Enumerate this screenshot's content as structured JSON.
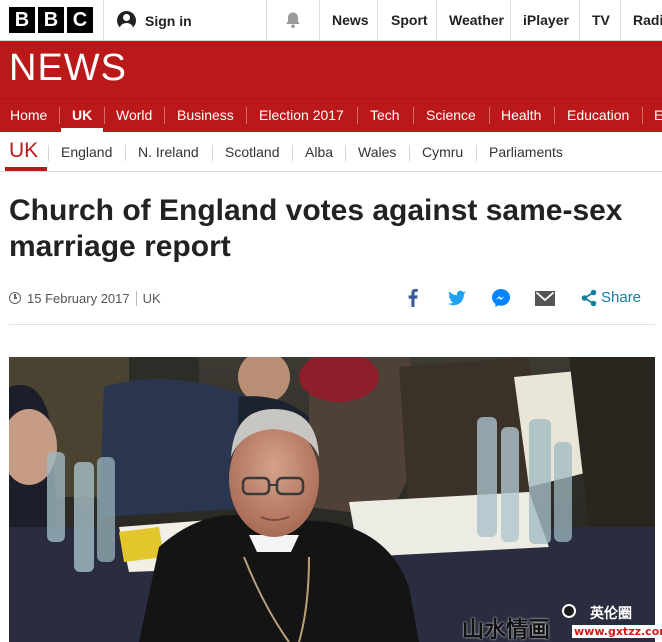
{
  "brand": {
    "logo_letters": [
      "B",
      "B",
      "C"
    ],
    "accent": "#bb1919"
  },
  "account": {
    "signin_label": "Sign in"
  },
  "topnav": [
    "News",
    "Sport",
    "Weather",
    "iPlayer",
    "TV",
    "Radi"
  ],
  "section_title": "NEWS",
  "mainnav": {
    "items": [
      "Home",
      "UK",
      "World",
      "Business",
      "Election 2017",
      "Tech",
      "Science",
      "Health",
      "Education",
      "E"
    ],
    "active": "UK"
  },
  "subnav": {
    "current": "UK",
    "items": [
      "England",
      "N. Ireland",
      "Scotland",
      "Alba",
      "Wales",
      "Cymru",
      "Parliaments"
    ]
  },
  "article": {
    "headline": "Church of England votes against same-sex marriage report",
    "date": "15 February 2017",
    "section": "UK"
  },
  "share": {
    "icons": [
      "facebook-icon",
      "twitter-icon",
      "messenger-icon",
      "email-icon",
      "share-icon"
    ],
    "label": "Share"
  },
  "watermark": {
    "left_text": "山水情画",
    "right_text": "英伦圈",
    "url_text": "www.gxtzz.com"
  }
}
